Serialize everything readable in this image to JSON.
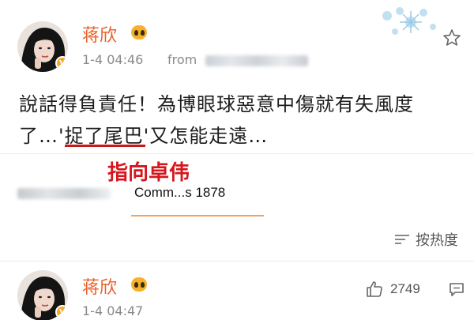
{
  "post": {
    "author": "蒋欣",
    "verified_badge": "V",
    "timestamp": "1-4 04:46",
    "source_prefix": "from",
    "text_line1": "說話得負責任！為博眼球惡意中傷就有失風度",
    "text_line2": "了…'捉了尾巴'又怎能走遠…",
    "annotation": "指向卓伟"
  },
  "comments": {
    "count_label": "Comm...s 1878",
    "sort_label": "按热度"
  },
  "next_post": {
    "author": "蒋欣",
    "verified_badge": "V",
    "timestamp": "1-4 04:47",
    "like_count": "2749"
  },
  "colors": {
    "name": "#e8612c",
    "annotation": "#d5171d",
    "underline": "#c81919",
    "meta": "#8a8a8a"
  },
  "icons": [
    "star-icon",
    "vip-icon",
    "sort-icon",
    "thumbs-up-icon",
    "comment-icon",
    "snowflake-decoration-icon"
  ]
}
